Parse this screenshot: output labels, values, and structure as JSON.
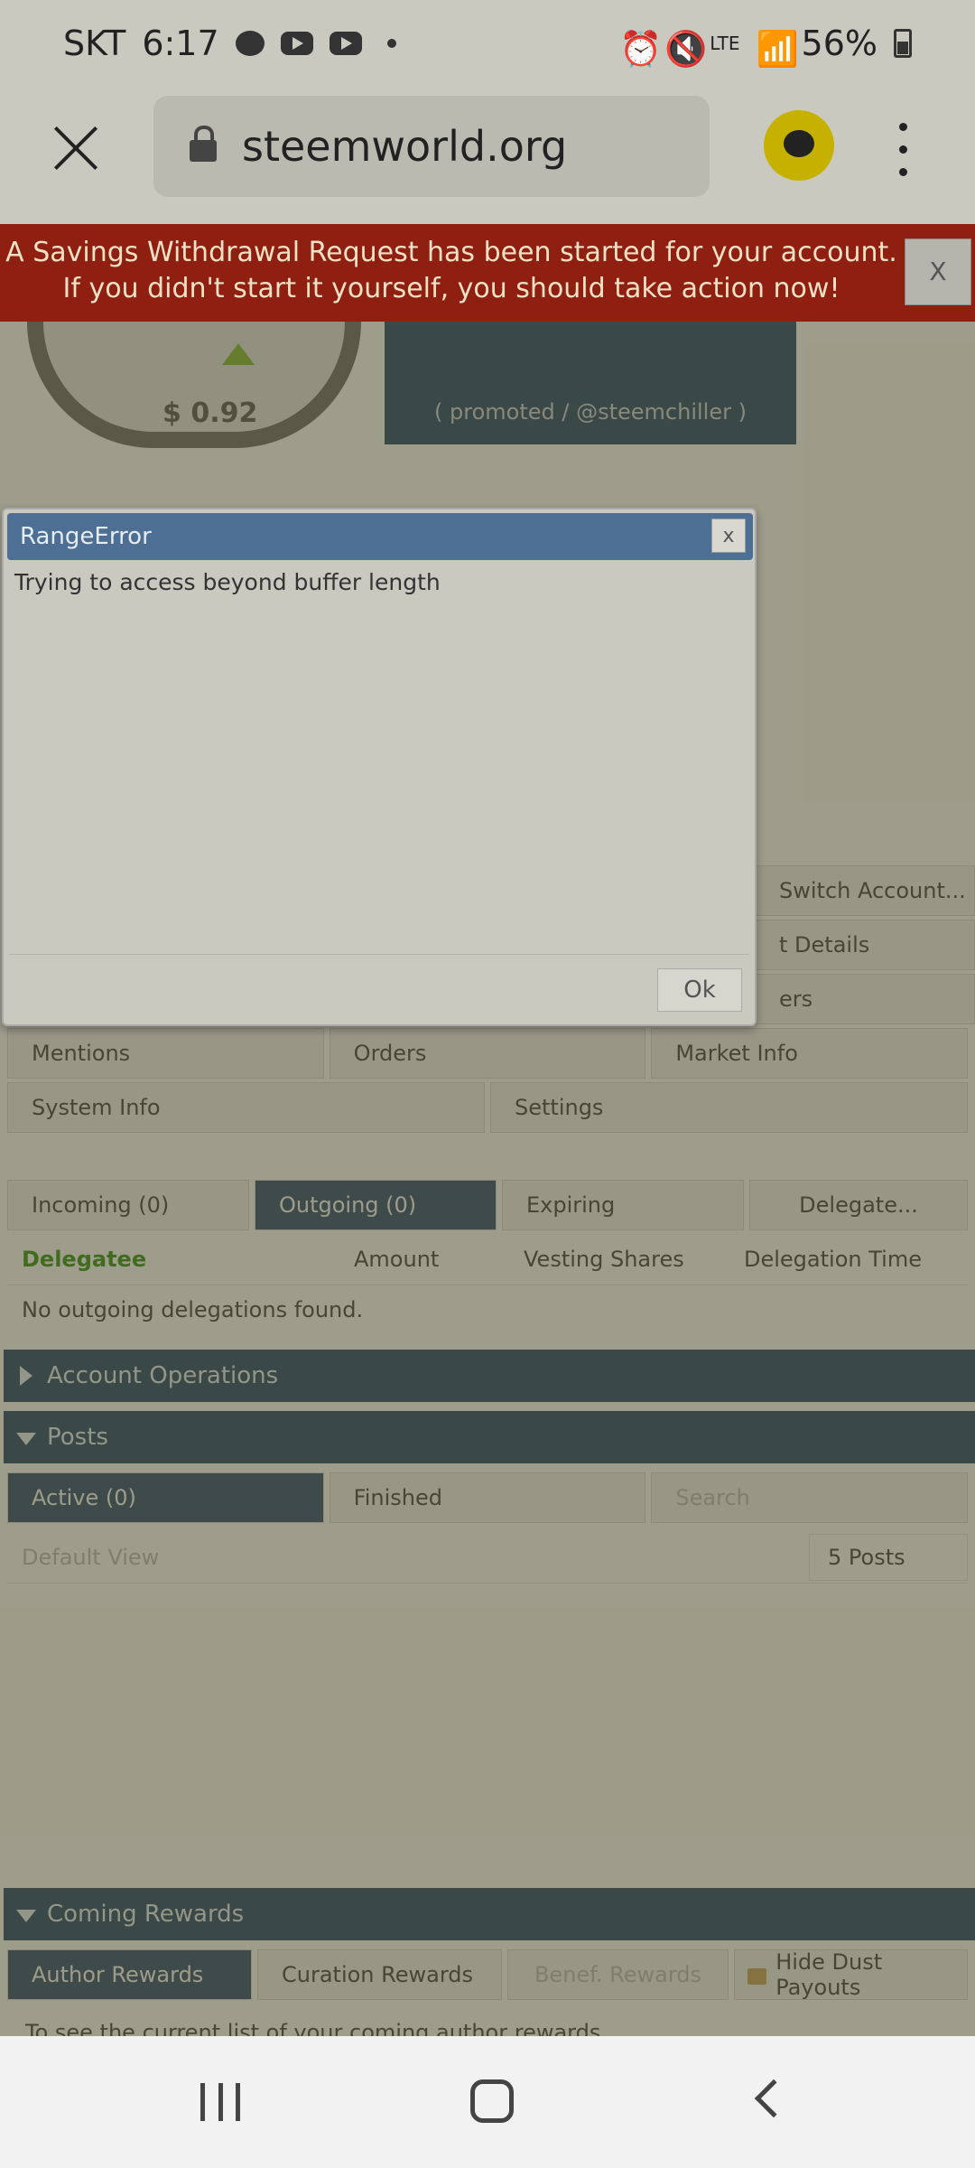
{
  "status_bar": {
    "carrier": "SKT",
    "time": "6:17",
    "talk_badge": "TALK",
    "network": "LTE",
    "battery": "56%"
  },
  "browser": {
    "url": "steemworld.org"
  },
  "notice": {
    "line1": "A Savings Withdrawal Request has been started for your account.",
    "line2": "If you didn't start it yourself, you should take action now!",
    "close_label": "X"
  },
  "gauge": {
    "value": "$ 0.92"
  },
  "promo": {
    "text": "( promoted / @steemchiller )"
  },
  "partial_buttons": {
    "switch_account": "Switch Account...",
    "account_details": "t Details",
    "others": "ers"
  },
  "nav_row1": [
    "Mentions",
    "Orders",
    "Market Info"
  ],
  "nav_row2": [
    "System Info",
    "Settings"
  ],
  "delegation_tabs": [
    "Incoming (0)",
    "Outgoing (0)",
    "Expiring",
    "Delegate..."
  ],
  "delegation_table": {
    "headers": [
      "Delegatee",
      "Amount",
      "Vesting Shares",
      "Delegation Time"
    ],
    "empty_message": "No outgoing delegations found."
  },
  "sections": {
    "account_operations": "Account Operations",
    "posts": "Posts",
    "coming_rewards": "Coming Rewards"
  },
  "posts_tabs": {
    "active": "Active (0)",
    "finished": "Finished",
    "search_placeholder": "Search",
    "default_view": "Default View",
    "posts_count": "5 Posts"
  },
  "reward_tabs": [
    "Author Rewards",
    "Curation Rewards",
    "Benef. Rewards",
    "Hide Dust Payouts"
  ],
  "rewards_text": "To see the current list of your coming author rewards...",
  "dialog": {
    "title": "RangeError",
    "close_label": "x",
    "message": "Trying to access beyond buffer length",
    "ok_label": "Ok"
  }
}
